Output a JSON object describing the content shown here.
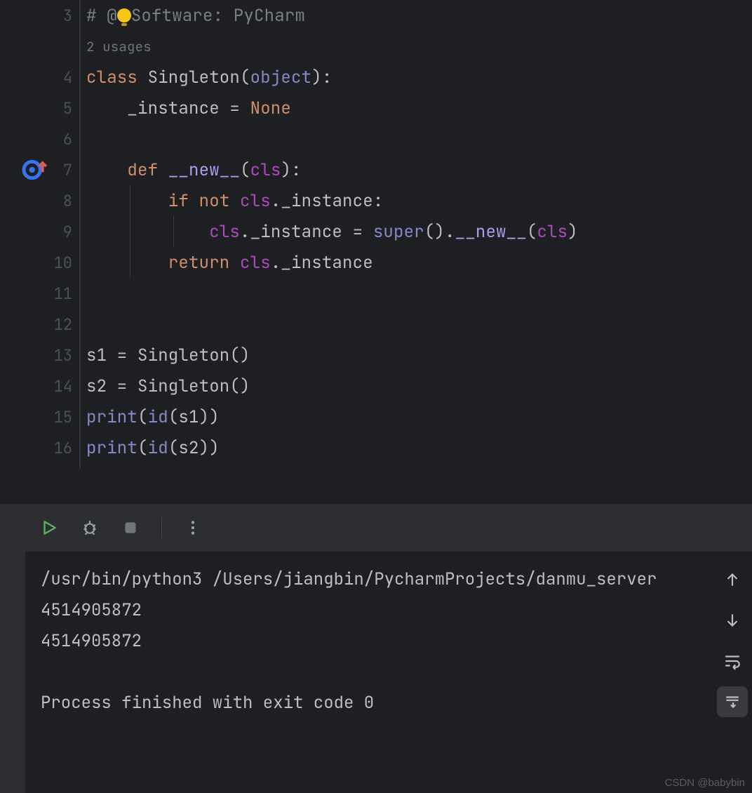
{
  "editor": {
    "first_line": 3,
    "usages_label": "2 usages",
    "lines": {
      "3": {
        "comment_pre": "# @",
        "comment_post": "Software: PyCharm"
      },
      "4": {
        "kw": "class ",
        "name": "Singleton",
        "paren_o": "(",
        "base": "object",
        "paren_c": "):"
      },
      "5": {
        "indent": "    ",
        "attr": "_instance = ",
        "none": "None"
      },
      "7": {
        "indent": "    ",
        "def": "def ",
        "dunder": "__new__",
        "sig_o": "(",
        "cls": "cls",
        "sig_c": "):"
      },
      "8": {
        "indent": "        ",
        "if": "if ",
        "not": "not ",
        "cls": "cls",
        "rest": "._instance:"
      },
      "9": {
        "indent": "            ",
        "cls1": "cls",
        "mid": "._instance = ",
        "super": "super",
        "callmid": "().",
        "dunder": "__new__",
        "o": "(",
        "cls2": "cls",
        "c": ")"
      },
      "10": {
        "indent": "        ",
        "ret": "return ",
        "cls": "cls",
        "rest": "._instance"
      },
      "13": {
        "text": "s1 = Singleton()"
      },
      "14": {
        "text": "s2 = Singleton()"
      },
      "15": {
        "fn": "print",
        "o": "(",
        "id": "id",
        "rest": "(s1))"
      },
      "16": {
        "fn": "print",
        "o": "(",
        "id": "id",
        "rest": "(s2))"
      }
    }
  },
  "console": {
    "cmd": "/usr/bin/python3 /Users/jiangbin/PycharmProjects/danmu_server",
    "out1": "4514905872",
    "out2": "4514905872",
    "exit": "Process finished with exit code 0"
  },
  "watermark": "CSDN @babybin",
  "gutter_numbers": [
    "3",
    "4",
    "5",
    "6",
    "7",
    "8",
    "9",
    "10",
    "11",
    "12",
    "13",
    "14",
    "15",
    "16"
  ]
}
